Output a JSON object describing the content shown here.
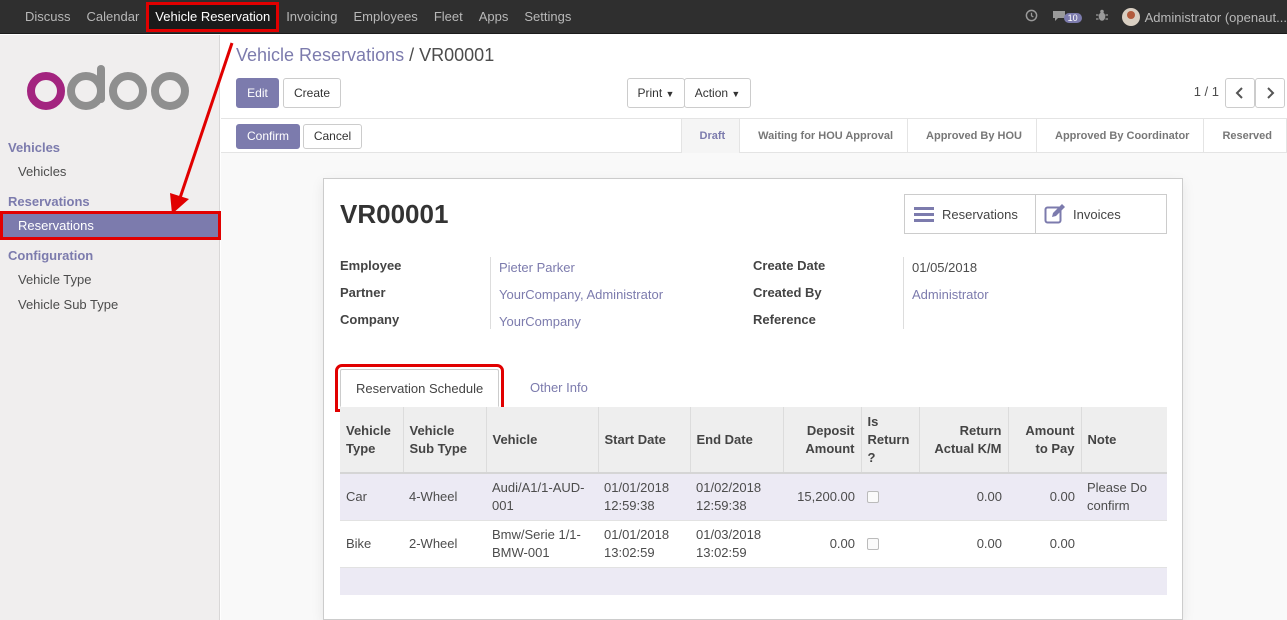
{
  "topnav": {
    "items": [
      "Discuss",
      "Calendar",
      "Vehicle Reservation",
      "Invoicing",
      "Employees",
      "Fleet",
      "Apps",
      "Settings"
    ],
    "active": "Vehicle Reservation",
    "message_count": "10",
    "user": "Administrator (openaut..."
  },
  "sidebar": {
    "logo_text": "odoo",
    "groups": [
      {
        "title": "Vehicles",
        "items": [
          "Vehicles"
        ]
      },
      {
        "title": "Reservations",
        "items": [
          "Reservations"
        ]
      },
      {
        "title": "Configuration",
        "items": [
          "Vehicle Type",
          "Vehicle Sub Type"
        ]
      }
    ]
  },
  "breadcrumb": {
    "parent": "Vehicle Reservations",
    "separator": "/",
    "current": "VR00001"
  },
  "toolbar": {
    "edit": "Edit",
    "create": "Create",
    "print": "Print",
    "action": "Action",
    "pager": "1 / 1"
  },
  "statusbar": {
    "confirm": "Confirm",
    "cancel": "Cancel",
    "stages": [
      "Draft",
      "Waiting for HOU Approval",
      "Approved By HOU",
      "Approved By Coordinator",
      "Reserved"
    ],
    "current_stage": "Draft"
  },
  "record": {
    "title": "VR00001",
    "smart_buttons": {
      "reservations": "Reservations",
      "invoices": "Invoices"
    },
    "left_fields": [
      {
        "label": "Employee",
        "value": "Pieter Parker"
      },
      {
        "label": "Partner",
        "value": "YourCompany, Administrator"
      },
      {
        "label": "Company",
        "value": "YourCompany"
      }
    ],
    "right_fields": [
      {
        "label": "Create Date",
        "value": "01/05/2018"
      },
      {
        "label": "Created By",
        "value": "Administrator"
      },
      {
        "label": "Reference",
        "value": ""
      }
    ]
  },
  "tabs": {
    "active": "Reservation Schedule",
    "other": "Other Info"
  },
  "schedule": {
    "headers": [
      "Vehicle Type",
      "Vehicle Sub Type",
      "Vehicle",
      "Start Date",
      "End Date",
      "Deposit Amount",
      "Is Return ?",
      "Return Actual K/M",
      "Amount to Pay",
      "Note"
    ],
    "rows": [
      {
        "type": "Car",
        "sub_type": "4-Wheel",
        "vehicle": "Audi/A1/1-AUD-001",
        "start": "01/01/2018 12:59:38",
        "end": "01/02/2018 12:59:38",
        "deposit": "15,200.00",
        "is_return": false,
        "return_km": "0.00",
        "amount_to_pay": "0.00",
        "note": "Please Do confirm"
      },
      {
        "type": "Bike",
        "sub_type": "2-Wheel",
        "vehicle": "Bmw/Serie 1/1-BMW-001",
        "start": "01/01/2018 13:02:59",
        "end": "01/03/2018 13:02:59",
        "deposit": "0.00",
        "is_return": false,
        "return_km": "0.00",
        "amount_to_pay": "0.00",
        "note": ""
      }
    ]
  },
  "colors": {
    "brand": "#7c7bad",
    "highlight": "#e10000",
    "navbar": "#2f2f2f",
    "logo_purple": "#a3247f",
    "logo_gray": "#8f8f8f"
  }
}
